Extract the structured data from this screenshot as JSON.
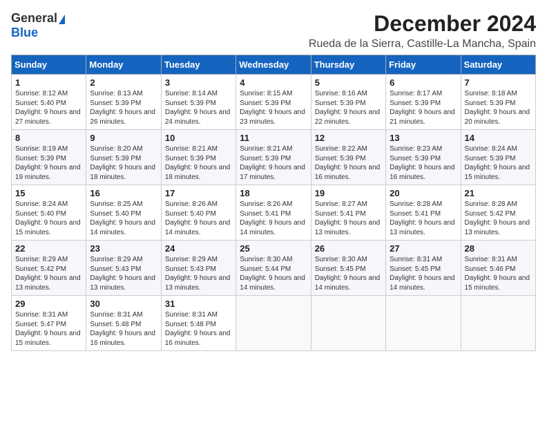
{
  "logo": {
    "general": "General",
    "blue": "Blue"
  },
  "title": "December 2024",
  "subtitle": "Rueda de la Sierra, Castille-La Mancha, Spain",
  "days_header": [
    "Sunday",
    "Monday",
    "Tuesday",
    "Wednesday",
    "Thursday",
    "Friday",
    "Saturday"
  ],
  "weeks": [
    [
      {
        "day": "1",
        "info": "Sunrise: 8:12 AM\nSunset: 5:40 PM\nDaylight: 9 hours and 27 minutes."
      },
      {
        "day": "2",
        "info": "Sunrise: 8:13 AM\nSunset: 5:39 PM\nDaylight: 9 hours and 26 minutes."
      },
      {
        "day": "3",
        "info": "Sunrise: 8:14 AM\nSunset: 5:39 PM\nDaylight: 9 hours and 24 minutes."
      },
      {
        "day": "4",
        "info": "Sunrise: 8:15 AM\nSunset: 5:39 PM\nDaylight: 9 hours and 23 minutes."
      },
      {
        "day": "5",
        "info": "Sunrise: 8:16 AM\nSunset: 5:39 PM\nDaylight: 9 hours and 22 minutes."
      },
      {
        "day": "6",
        "info": "Sunrise: 8:17 AM\nSunset: 5:39 PM\nDaylight: 9 hours and 21 minutes."
      },
      {
        "day": "7",
        "info": "Sunrise: 8:18 AM\nSunset: 5:39 PM\nDaylight: 9 hours and 20 minutes."
      }
    ],
    [
      {
        "day": "8",
        "info": "Sunrise: 8:19 AM\nSunset: 5:39 PM\nDaylight: 9 hours and 19 minutes."
      },
      {
        "day": "9",
        "info": "Sunrise: 8:20 AM\nSunset: 5:39 PM\nDaylight: 9 hours and 18 minutes."
      },
      {
        "day": "10",
        "info": "Sunrise: 8:21 AM\nSunset: 5:39 PM\nDaylight: 9 hours and 18 minutes."
      },
      {
        "day": "11",
        "info": "Sunrise: 8:21 AM\nSunset: 5:39 PM\nDaylight: 9 hours and 17 minutes."
      },
      {
        "day": "12",
        "info": "Sunrise: 8:22 AM\nSunset: 5:39 PM\nDaylight: 9 hours and 16 minutes."
      },
      {
        "day": "13",
        "info": "Sunrise: 8:23 AM\nSunset: 5:39 PM\nDaylight: 9 hours and 16 minutes."
      },
      {
        "day": "14",
        "info": "Sunrise: 8:24 AM\nSunset: 5:39 PM\nDaylight: 9 hours and 15 minutes."
      }
    ],
    [
      {
        "day": "15",
        "info": "Sunrise: 8:24 AM\nSunset: 5:40 PM\nDaylight: 9 hours and 15 minutes."
      },
      {
        "day": "16",
        "info": "Sunrise: 8:25 AM\nSunset: 5:40 PM\nDaylight: 9 hours and 14 minutes."
      },
      {
        "day": "17",
        "info": "Sunrise: 8:26 AM\nSunset: 5:40 PM\nDaylight: 9 hours and 14 minutes."
      },
      {
        "day": "18",
        "info": "Sunrise: 8:26 AM\nSunset: 5:41 PM\nDaylight: 9 hours and 14 minutes."
      },
      {
        "day": "19",
        "info": "Sunrise: 8:27 AM\nSunset: 5:41 PM\nDaylight: 9 hours and 13 minutes."
      },
      {
        "day": "20",
        "info": "Sunrise: 8:28 AM\nSunset: 5:41 PM\nDaylight: 9 hours and 13 minutes."
      },
      {
        "day": "21",
        "info": "Sunrise: 8:28 AM\nSunset: 5:42 PM\nDaylight: 9 hours and 13 minutes."
      }
    ],
    [
      {
        "day": "22",
        "info": "Sunrise: 8:29 AM\nSunset: 5:42 PM\nDaylight: 9 hours and 13 minutes."
      },
      {
        "day": "23",
        "info": "Sunrise: 8:29 AM\nSunset: 5:43 PM\nDaylight: 9 hours and 13 minutes."
      },
      {
        "day": "24",
        "info": "Sunrise: 8:29 AM\nSunset: 5:43 PM\nDaylight: 9 hours and 13 minutes."
      },
      {
        "day": "25",
        "info": "Sunrise: 8:30 AM\nSunset: 5:44 PM\nDaylight: 9 hours and 14 minutes."
      },
      {
        "day": "26",
        "info": "Sunrise: 8:30 AM\nSunset: 5:45 PM\nDaylight: 9 hours and 14 minutes."
      },
      {
        "day": "27",
        "info": "Sunrise: 8:31 AM\nSunset: 5:45 PM\nDaylight: 9 hours and 14 minutes."
      },
      {
        "day": "28",
        "info": "Sunrise: 8:31 AM\nSunset: 5:46 PM\nDaylight: 9 hours and 15 minutes."
      }
    ],
    [
      {
        "day": "29",
        "info": "Sunrise: 8:31 AM\nSunset: 5:47 PM\nDaylight: 9 hours and 15 minutes."
      },
      {
        "day": "30",
        "info": "Sunrise: 8:31 AM\nSunset: 5:48 PM\nDaylight: 9 hours and 16 minutes."
      },
      {
        "day": "31",
        "info": "Sunrise: 8:31 AM\nSunset: 5:48 PM\nDaylight: 9 hours and 16 minutes."
      },
      null,
      null,
      null,
      null
    ]
  ]
}
